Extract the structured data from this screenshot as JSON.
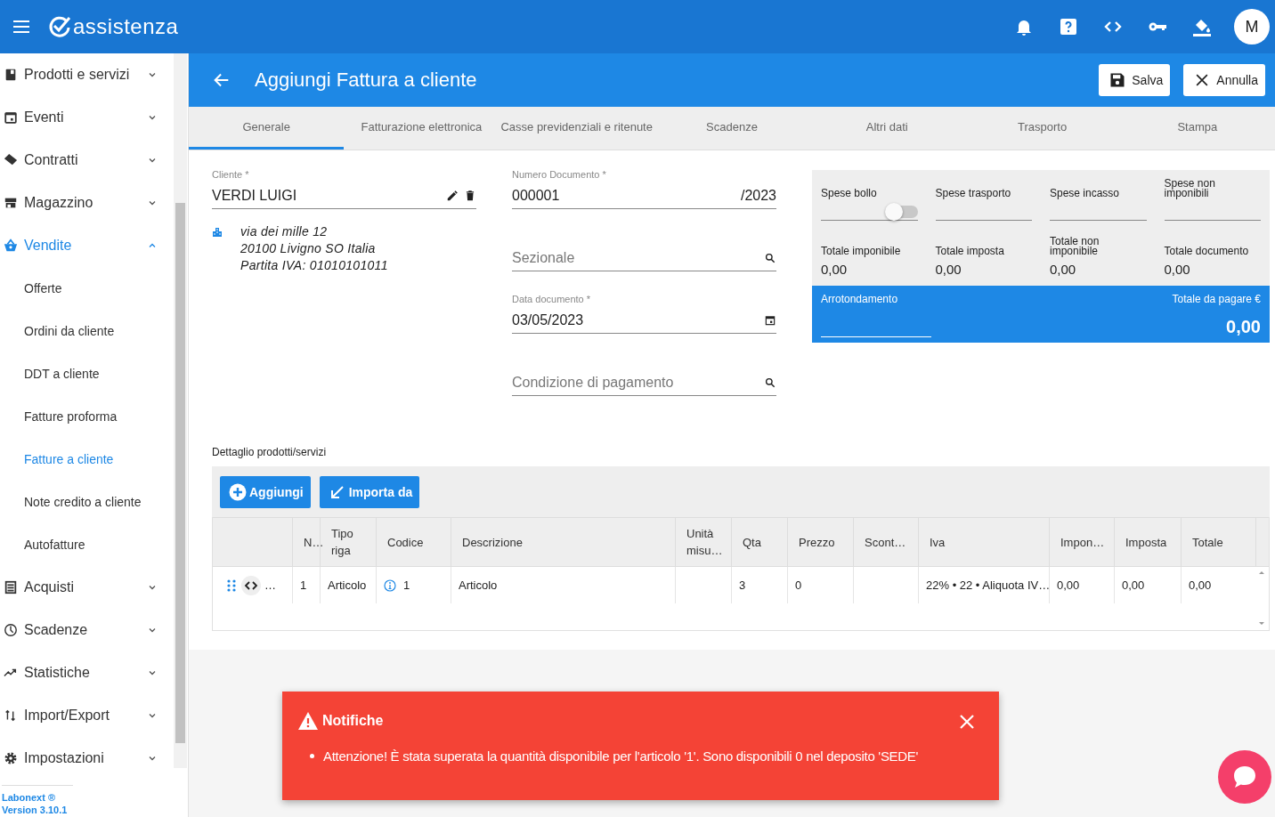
{
  "app": {
    "logo": "assistenza",
    "avatar": "M"
  },
  "sidebar": {
    "items": [
      {
        "label": "Prodotti e servizi",
        "expanded": false,
        "selected": false
      },
      {
        "label": "Eventi",
        "expanded": false,
        "selected": false
      },
      {
        "label": "Contratti",
        "expanded": false,
        "selected": false
      },
      {
        "label": "Magazzino",
        "expanded": false,
        "selected": false
      },
      {
        "label": "Vendite",
        "expanded": true,
        "selected": true,
        "children": [
          {
            "label": "Offerte",
            "selected": false
          },
          {
            "label": "Ordini da cliente",
            "selected": false
          },
          {
            "label": "DDT a cliente",
            "selected": false
          },
          {
            "label": "Fatture proforma",
            "selected": false
          },
          {
            "label": "Fatture a cliente",
            "selected": true
          },
          {
            "label": "Note credito a cliente",
            "selected": false
          },
          {
            "label": "Autofatture",
            "selected": false
          }
        ]
      },
      {
        "label": "Acquisti",
        "expanded": false,
        "selected": false
      },
      {
        "label": "Scadenze",
        "expanded": false,
        "selected": false
      },
      {
        "label": "Statistiche",
        "expanded": false,
        "selected": false
      },
      {
        "label": "Import/Export",
        "expanded": false,
        "selected": false
      },
      {
        "label": "Impostazioni",
        "expanded": false,
        "selected": false
      }
    ],
    "footer": [
      "Labonext ®",
      "Version 3.10.1"
    ]
  },
  "page": {
    "title": "Aggiungi Fattura a cliente",
    "buttons": [
      "Salva",
      "Annulla"
    ]
  },
  "tabs": [
    {
      "label": "Generale",
      "selected": true
    },
    {
      "label": "Fatturazione elettronica",
      "selected": false
    },
    {
      "label": "Casse previdenziali e ritenute",
      "selected": false
    },
    {
      "label": "Scadenze",
      "selected": false
    },
    {
      "label": "Altri dati",
      "selected": false
    },
    {
      "label": "Trasporto",
      "selected": false
    },
    {
      "label": "Stampa",
      "selected": false
    }
  ],
  "form": {
    "cliente": {
      "label": "Cliente *",
      "value": "VERDI LUIGI"
    },
    "address": [
      "via dei mille 12",
      "20100 Livigno SO Italia",
      "Partita IVA: 01010101011"
    ],
    "numero": {
      "label": "Numero Documento *",
      "value": "000001",
      "suffix": "/2023"
    },
    "sezionale": {
      "placeholder": "Sezionale"
    },
    "data": {
      "label": "Data documento *",
      "value": "03/05/2023"
    },
    "condizione": {
      "placeholder": "Condizione di pagamento"
    }
  },
  "summary": {
    "spese": [
      {
        "label": "Spese bollo",
        "toggle": false
      },
      {
        "label": "Spese trasporto"
      },
      {
        "label": "Spese incasso"
      },
      {
        "label": "Spese non imponibili"
      }
    ],
    "totals": [
      {
        "label": "Totale imponibile",
        "value": "0,00"
      },
      {
        "label": "Totale imposta",
        "value": "0,00"
      },
      {
        "label": "Totale non imponibile",
        "value": "0,00"
      },
      {
        "label": "Totale documento",
        "value": "0,00"
      }
    ],
    "arrotondamento": "Arrotondamento",
    "totale_label": "Totale da pagare €",
    "totale_value": "0,00"
  },
  "detail": {
    "title": "Dettaglio prodotti/servizi",
    "buttons": [
      "Aggiungi",
      "Importa da"
    ],
    "columns": [
      "N…",
      "Tipo riga",
      "Codice",
      "Descrizione",
      "Unità misu…",
      "Qta",
      "Prezzo",
      "Scont…",
      "Iva",
      "Impon…",
      "Imposta",
      "Totale"
    ],
    "rows": [
      {
        "handle": "…",
        "cells": [
          "1",
          "Articolo",
          "1",
          "Articolo",
          "",
          "3",
          "0",
          "",
          "22% • 22 • Aliquota IV…",
          "0,00",
          "0,00",
          "0,00"
        ]
      }
    ]
  },
  "notification": {
    "title": "Notifiche",
    "messages": [
      "Attenzione! È stata superata la quantità disponibile per l'articolo '1'. Sono disponibili 0 nel deposito 'SEDE'"
    ]
  }
}
